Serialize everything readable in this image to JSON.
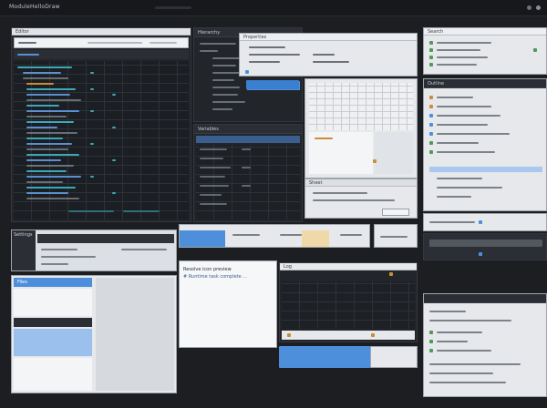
{
  "app": {
    "title": "ModuleHelloDraw"
  },
  "panels": {
    "code_editor": {
      "tab": "Editor"
    },
    "inspector": {
      "title": "Hierarchy"
    },
    "properties_top": {
      "title": "Properties"
    },
    "right_top": {
      "title": "Search"
    },
    "right_mid": {
      "title": "Outline"
    },
    "variables": {
      "title": "Variables"
    },
    "sheet": {
      "title": "Sheet"
    },
    "editor_bottom": {
      "title": "Console",
      "line1": "Resolve icon preview",
      "line2": "# Runtime task complete ..."
    },
    "files": {
      "title": "Files"
    },
    "log": {
      "title": "Log"
    },
    "settings": {
      "title": "Settings"
    }
  },
  "colors": {
    "accent": "#4e8fdc",
    "background": "#1c1e22",
    "warning": "#c98d3a",
    "ok": "#4f9a57"
  }
}
